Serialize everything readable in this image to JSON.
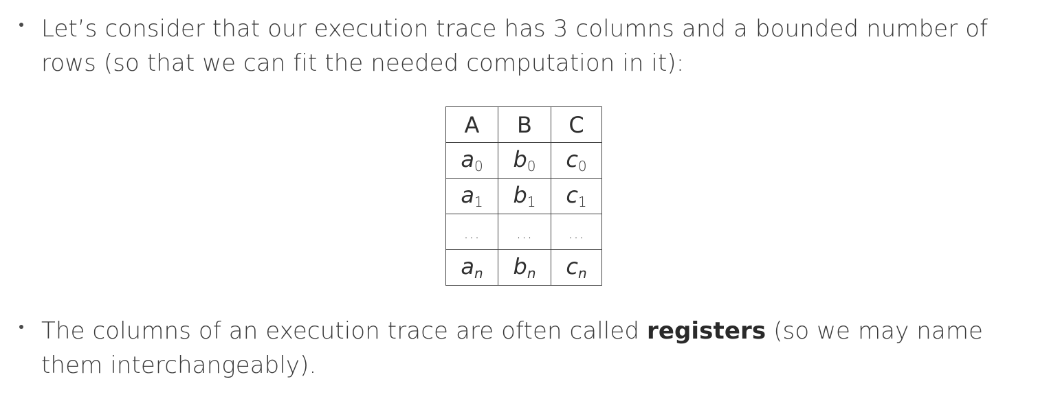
{
  "bullets": [
    {
      "text": "Let’s consider that our execution trace has 3 columns and a bounded number of rows (so that we can fit the needed computation in it):"
    },
    {
      "text_before": "The columns of an execution trace are often called ",
      "bold": "registers",
      "text_after": " (so we may name them interchangeably)."
    }
  ],
  "table": {
    "headers": [
      "A",
      "B",
      "C"
    ],
    "rows": [
      [
        {
          "v": "a",
          "s": "0"
        },
        {
          "v": "b",
          "s": "0"
        },
        {
          "v": "c",
          "s": "0"
        }
      ],
      [
        {
          "v": "a",
          "s": "1"
        },
        {
          "v": "b",
          "s": "1"
        },
        {
          "v": "c",
          "s": "1"
        }
      ],
      [
        {
          "v": "...",
          "s": ""
        },
        {
          "v": "...",
          "s": ""
        },
        {
          "v": "...",
          "s": ""
        }
      ],
      [
        {
          "v": "a",
          "s": "n"
        },
        {
          "v": "b",
          "s": "n"
        },
        {
          "v": "c",
          "s": "n"
        }
      ]
    ]
  }
}
